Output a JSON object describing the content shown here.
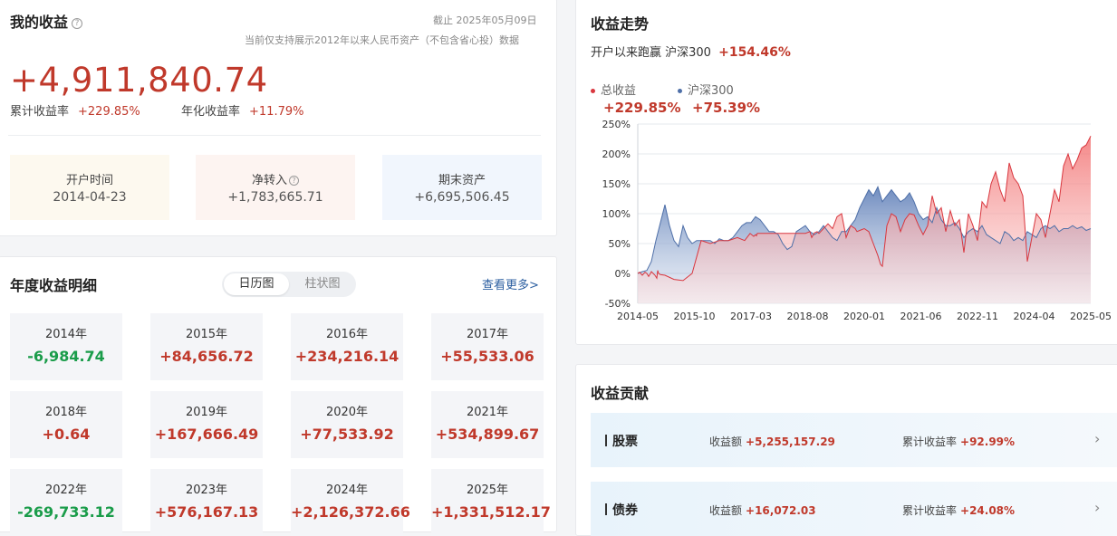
{
  "summary": {
    "title": "我的收益",
    "help_icon": "question-icon",
    "as_of": "截止 2025年05月09日",
    "note": "当前仅支持展示2012年以来人民币资产（不包含省心投）数据",
    "total_profit": "+4,911,840.74",
    "cum_rate_label": "累计收益率",
    "cum_rate_value": "+229.85%",
    "annual_rate_label": "年化收益率",
    "annual_rate_value": "+11.79%",
    "boxes": [
      {
        "label": "开户时间",
        "value": "2014-04-23",
        "bg": "#fdf9ef"
      },
      {
        "label": "净转入",
        "value": "+1,783,665.71",
        "bg": "#fdf4f1"
      },
      {
        "label": "期末资产",
        "value": "+6,695,506.45",
        "bg": "#f1f6fd"
      }
    ]
  },
  "annual": {
    "title": "年度收益明细",
    "toggle_on": "日历图",
    "toggle_off": "柱状图",
    "more": "查看更多>",
    "years": [
      {
        "year": "2014年",
        "value": "-6,984.74"
      },
      {
        "year": "2015年",
        "value": "+84,656.72"
      },
      {
        "year": "2016年",
        "value": "+234,216.14"
      },
      {
        "year": "2017年",
        "value": "+55,533.06"
      },
      {
        "year": "2018年",
        "value": "+0.64"
      },
      {
        "year": "2019年",
        "value": "+167,666.49"
      },
      {
        "year": "2020年",
        "value": "+77,533.92"
      },
      {
        "year": "2021年",
        "value": "+534,899.67"
      },
      {
        "year": "2022年",
        "value": "-269,733.12"
      },
      {
        "year": "2023年",
        "value": "+576,167.13"
      },
      {
        "year": "2024年",
        "value": "+2,126,372.66"
      },
      {
        "year": "2025年",
        "value": "+1,331,512.17"
      }
    ]
  },
  "trend": {
    "title": "收益走势",
    "beat_text": "开户以来跑赢 沪深300",
    "beat_value": "+154.46%",
    "legend": [
      {
        "name": "总收益",
        "value": "+229.85%",
        "color": "#d9363e"
      },
      {
        "name": "沪深300",
        "value": "+75.39%",
        "color": "#4e6fa8"
      }
    ]
  },
  "chart_data": {
    "type": "area",
    "title": "",
    "xlabel": "",
    "ylabel": "",
    "x_ticks": [
      "2014-05",
      "2015-10",
      "2017-03",
      "2018-08",
      "2020-01",
      "2021-06",
      "2022-11",
      "2024-04",
      "2025-05"
    ],
    "y_ticks": [
      "250%",
      "200%",
      "150%",
      "100%",
      "50%",
      "0%",
      "-50%"
    ],
    "ylim": [
      -50,
      250
    ],
    "grid": true,
    "series": [
      {
        "name": "总收益",
        "color": "#d9363e",
        "x": [
          0,
          2,
          5,
          8,
          10,
          12,
          14,
          15,
          17,
          19,
          21,
          22,
          23,
          25,
          30,
          40,
          50,
          60,
          70,
          80,
          90,
          100,
          110,
          118,
          124,
          128,
          130,
          131,
          132,
          135,
          140,
          145,
          150,
          152,
          155,
          158,
          162,
          166,
          170,
          175,
          180,
          185,
          190,
          192,
          195,
          198,
          200,
          205,
          210,
          215,
          220,
          225,
          230,
          235,
          240,
          242,
          245,
          250,
          255,
          260,
          265,
          268,
          270,
          275,
          280,
          285,
          290,
          295,
          300,
          305,
          310,
          315,
          320,
          325,
          330,
          335,
          340,
          345,
          350,
          355,
          360,
          365,
          370,
          375,
          380,
          385,
          390,
          395,
          400,
          405,
          410,
          415,
          420,
          425,
          430,
          435,
          440,
          445,
          450,
          455,
          460,
          465,
          470,
          475,
          480,
          485,
          490,
          495,
          500
        ],
        "values": [
          0,
          2,
          -3,
          2,
          0,
          -5,
          0,
          3,
          0,
          -3,
          -8,
          5,
          0,
          -2,
          -3,
          -10,
          -12,
          0,
          55,
          50,
          55,
          55,
          60,
          55,
          67,
          62,
          65,
          63,
          67,
          67,
          67,
          67,
          67,
          67,
          67,
          67,
          67,
          67,
          67,
          67,
          67,
          67,
          70,
          60,
          68,
          70,
          67,
          75,
          83,
          75,
          95,
          100,
          60,
          80,
          75,
          70,
          72,
          75,
          70,
          50,
          30,
          15,
          12,
          80,
          100,
          95,
          70,
          90,
          100,
          98,
          80,
          65,
          80,
          130,
          100,
          110,
          70,
          105,
          80,
          90,
          35,
          100,
          80,
          55,
          120,
          110,
          150,
          170,
          140,
          120,
          185,
          160,
          150,
          130,
          20,
          60,
          100,
          90,
          60,
          100,
          140,
          120,
          180,
          200,
          175,
          190,
          210,
          215,
          230
        ]
      },
      {
        "name": "沪深300",
        "color": "#4e6fa8",
        "x": [
          0,
          5,
          10,
          15,
          20,
          25,
          30,
          35,
          40,
          45,
          50,
          55,
          60,
          65,
          70,
          75,
          80,
          85,
          90,
          95,
          100,
          105,
          110,
          115,
          120,
          125,
          130,
          135,
          140,
          145,
          150,
          155,
          160,
          165,
          170,
          175,
          180,
          185,
          190,
          195,
          200,
          205,
          210,
          215,
          220,
          225,
          230,
          235,
          240,
          245,
          250,
          255,
          260,
          265,
          270,
          275,
          280,
          285,
          290,
          295,
          300,
          305,
          310,
          315,
          320,
          325,
          330,
          335,
          340,
          345,
          350,
          355,
          360,
          365,
          370,
          375,
          380,
          385,
          390,
          395,
          400,
          405,
          410,
          415,
          420,
          425,
          430,
          435,
          440,
          445,
          450,
          455,
          460,
          465,
          470,
          475,
          480,
          485,
          490,
          495,
          500
        ],
        "values": [
          0,
          3,
          5,
          20,
          55,
          85,
          115,
          80,
          55,
          45,
          80,
          60,
          50,
          55,
          55,
          55,
          55,
          50,
          58,
          55,
          55,
          60,
          70,
          80,
          85,
          85,
          95,
          90,
          80,
          70,
          70,
          65,
          50,
          40,
          45,
          70,
          75,
          80,
          70,
          65,
          70,
          80,
          70,
          60,
          55,
          70,
          70,
          80,
          90,
          110,
          125,
          140,
          130,
          145,
          120,
          130,
          140,
          130,
          120,
          125,
          135,
          120,
          100,
          90,
          95,
          85,
          110,
          90,
          80,
          80,
          85,
          75,
          60,
          70,
          75,
          70,
          80,
          65,
          60,
          55,
          50,
          70,
          65,
          55,
          60,
          55,
          70,
          65,
          60,
          75,
          80,
          75,
          80,
          70,
          75,
          75,
          80,
          75,
          78,
          72,
          75
        ]
      }
    ]
  },
  "contrib": {
    "title": "收益贡献",
    "amount_label": "收益额",
    "rate_label": "累计收益率",
    "chevron_icon": "chevron-right-icon",
    "rows": [
      {
        "name": "股票",
        "amount": "+5,255,157.29",
        "rate": "+92.99%"
      },
      {
        "name": "债券",
        "amount": "+16,072.03",
        "rate": "+24.08%"
      }
    ]
  }
}
